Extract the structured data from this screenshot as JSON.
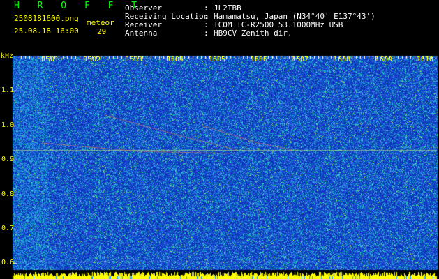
{
  "header": {
    "brand": "H R O F F T",
    "filename": "2508181600.png",
    "datetime": "25.08.18 16:00",
    "meteor_label": "meteor",
    "meteor_count": "29",
    "fields": [
      {
        "label": "Observer",
        "sep": ":",
        "value": "JL2TBB"
      },
      {
        "label": "Receiving Location",
        "sep": ":",
        "value": "Hamamatsu, Japan (N34°40' E137°43')"
      },
      {
        "label": "Receiver",
        "sep": ":",
        "value": "ICOM IC-R2500 53.1000MHz USB"
      },
      {
        "label": "Antenna",
        "sep": ":",
        "value": "HB9CV Zenith dir."
      }
    ]
  },
  "axis": {
    "unit": "kHz",
    "y_ticks": [
      "1.1",
      "1.0",
      "0.9",
      "0.8",
      "0.7",
      "0.6"
    ],
    "x_ticks": [
      "1601",
      "1602",
      "1603",
      "1604",
      "1605",
      "1606",
      "1607",
      "1608",
      "1609",
      "1610"
    ]
  },
  "colors": {
    "background": "#000000",
    "label_green": "#00ff00",
    "label_yellow": "#ffff00",
    "label_white": "#ffffff",
    "waterfall_base": "#1a3cc8",
    "signal_bar": "#ffff00"
  }
}
